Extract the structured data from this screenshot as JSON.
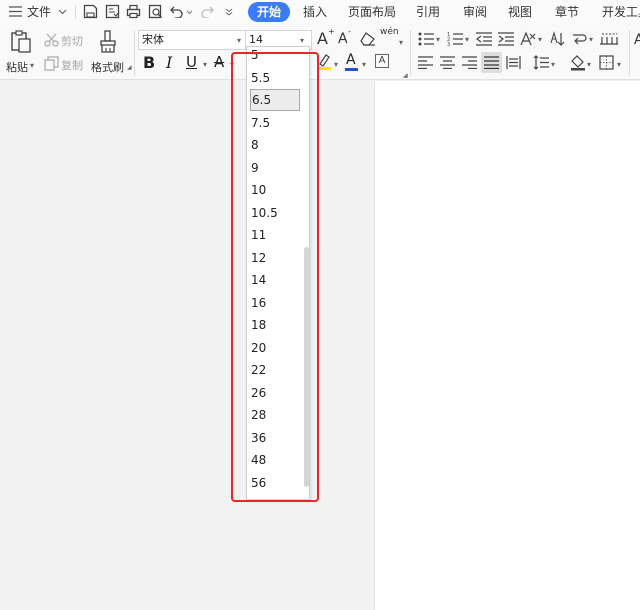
{
  "menu": {
    "file_label": "文件",
    "tabs": [
      "开始",
      "插入",
      "页面布局",
      "引用",
      "审阅",
      "视图",
      "章节",
      "开发工具"
    ]
  },
  "ribbon": {
    "paste_label": "粘贴",
    "cut_label": "剪切",
    "copy_label": "复制",
    "format_painter_label": "格式刷",
    "font_name": "宋体",
    "font_size": "14",
    "bold_glyph": "B",
    "italic_glyph": "I",
    "underline_glyph": "U",
    "increase_font_glyph": "A",
    "decrease_font_glyph": "A",
    "phonetic_glyph": "wén",
    "font_color_glyph": "A",
    "char_border_glyph": "A",
    "strike_glyph": "A",
    "style_glyph": "A"
  },
  "font_size_dropdown": {
    "options": [
      "5",
      "5.5",
      "6.5",
      "7.5",
      "8",
      "9",
      "10",
      "10.5",
      "11",
      "12",
      "14",
      "16",
      "18",
      "20",
      "22",
      "26",
      "28",
      "36",
      "48",
      "56"
    ],
    "selected": "6.5"
  },
  "colors": {
    "accent": "#3a7bff",
    "highlight_border": "#e8262a",
    "font_color_bar": "#2e4bd6",
    "highlight_bar": "#ffe800"
  }
}
